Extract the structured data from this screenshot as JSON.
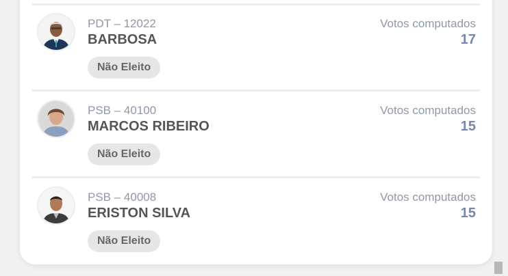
{
  "candidates": [
    {
      "party": "PDT – 12022",
      "name": "BARBOSA",
      "status": "Não Eleito",
      "votes_label": "Votos computados",
      "votes": "17"
    },
    {
      "party": "PSB – 40100",
      "name": "MARCOS RIBEIRO",
      "status": "Não Eleito",
      "votes_label": "Votos computados",
      "votes": "15"
    },
    {
      "party": "PSB – 40008",
      "name": "ERISTON SILVA",
      "status": "Não Eleito",
      "votes_label": "Votos computados",
      "votes": "15"
    }
  ],
  "colors": {
    "party_text": "#8f98a8",
    "name_text": "#555555",
    "votes_value": "#7088b0",
    "badge_bg": "#e6e6e6"
  }
}
